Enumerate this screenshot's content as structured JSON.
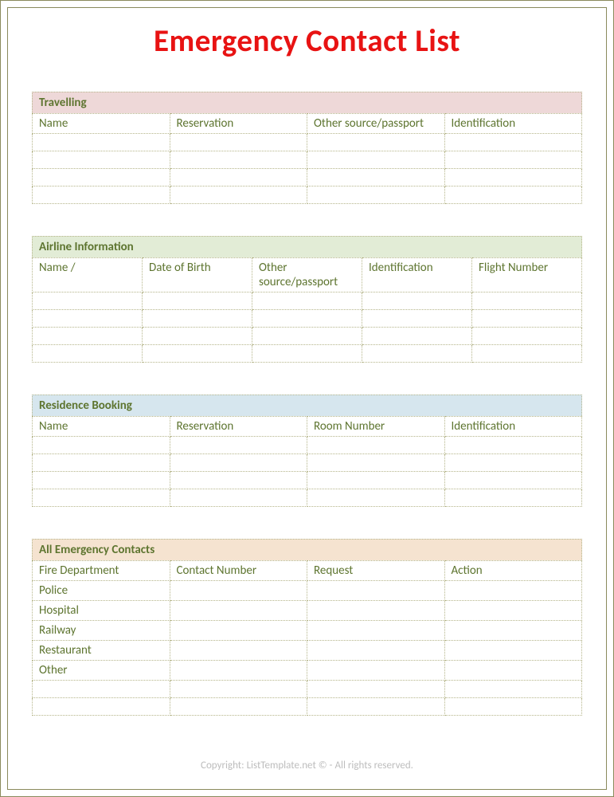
{
  "title": "Emergency Contact List",
  "sections": {
    "travelling": {
      "label": "Travelling",
      "headers": [
        "Name",
        "Reservation",
        "Other source/passport",
        "Identification"
      ],
      "rows": [
        [
          "",
          "",
          "",
          ""
        ],
        [
          "",
          "",
          "",
          ""
        ],
        [
          "",
          "",
          "",
          ""
        ],
        [
          "",
          "",
          "",
          ""
        ]
      ]
    },
    "airline": {
      "label": "Airline Information",
      "headers": [
        "Name /",
        "Date of Birth",
        "Other source/passport",
        "Identification",
        "Flight Number"
      ],
      "rows": [
        [
          "",
          "",
          "",
          "",
          ""
        ],
        [
          "",
          "",
          "",
          "",
          ""
        ],
        [
          "",
          "",
          "",
          "",
          ""
        ],
        [
          "",
          "",
          "",
          "",
          ""
        ]
      ]
    },
    "residence": {
      "label": "Residence Booking",
      "headers": [
        "Name",
        "Reservation",
        "Room Number",
        "Identification"
      ],
      "rows": [
        [
          "",
          "",
          "",
          ""
        ],
        [
          "",
          "",
          "",
          ""
        ],
        [
          "",
          "",
          "",
          ""
        ],
        [
          "",
          "",
          "",
          ""
        ]
      ]
    },
    "emergency": {
      "label": "All Emergency Contacts",
      "headers": [
        "Fire Department",
        "Contact Number",
        "Request",
        "Action"
      ],
      "rows": [
        [
          "Police",
          "",
          "",
          ""
        ],
        [
          "Hospital",
          "",
          "",
          ""
        ],
        [
          "Railway",
          "",
          "",
          ""
        ],
        [
          "Restaurant",
          "",
          "",
          ""
        ],
        [
          "Other",
          "",
          "",
          ""
        ],
        [
          "",
          "",
          "",
          ""
        ],
        [
          "",
          "",
          "",
          ""
        ]
      ]
    }
  },
  "copyright": "Copyright: ListTemplate.net © - All rights reserved."
}
